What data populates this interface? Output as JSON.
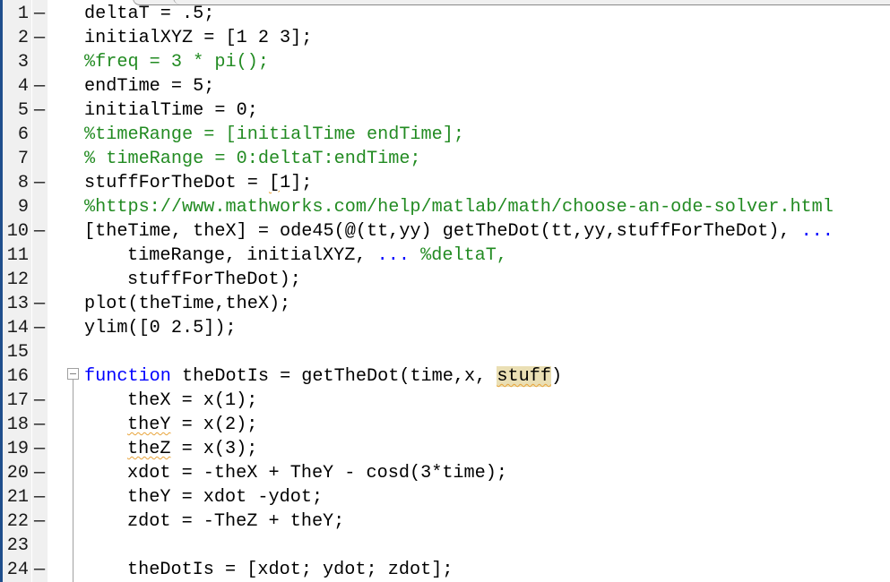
{
  "editor": {
    "language": "MATLAB",
    "colors": {
      "comment": "#228b22",
      "keyword": "#0000ff",
      "continuation": "#0000ff",
      "highlight": "#eadfb4",
      "warning_underline": "#e8a33a"
    },
    "lines": [
      {
        "number": "1",
        "executable": true,
        "tokens": [
          {
            "t": "deltaT = .5;"
          }
        ]
      },
      {
        "number": "2",
        "executable": true,
        "tokens": [
          {
            "t": "initialXYZ = [1 2 3];"
          }
        ]
      },
      {
        "number": "3",
        "executable": false,
        "tokens": [
          {
            "t": "%freq = 3 * pi();",
            "c": "comment"
          }
        ]
      },
      {
        "number": "4",
        "executable": true,
        "tokens": [
          {
            "t": "endTime = 5;"
          }
        ]
      },
      {
        "number": "5",
        "executable": true,
        "tokens": [
          {
            "t": "initialTime = 0;"
          }
        ]
      },
      {
        "number": "6",
        "executable": false,
        "tokens": [
          {
            "t": "%timeRange = [initialTime endTime];",
            "c": "comment"
          }
        ]
      },
      {
        "number": "7",
        "executable": false,
        "tokens": [
          {
            "t": "% timeRange = 0:deltaT:endTime;",
            "c": "comment"
          }
        ]
      },
      {
        "number": "8",
        "executable": true,
        "tokens": [
          {
            "t": "stuffForTheDot = "
          },
          {
            "t": "[",
            "c": "warn"
          },
          {
            "t": "1];"
          }
        ]
      },
      {
        "number": "9",
        "executable": false,
        "tokens": [
          {
            "t": "%https://www.mathworks.com/help/matlab/math/choose-an-ode-solver.html",
            "c": "comment"
          }
        ]
      },
      {
        "number": "10",
        "executable": true,
        "tokens": [
          {
            "t": "[theTime, theX] = ode45(@(tt,yy) getTheDot(tt,yy,stuffForTheDot), "
          },
          {
            "t": "...",
            "c": "cont"
          }
        ]
      },
      {
        "number": "11",
        "executable": false,
        "indent": 1,
        "tokens": [
          {
            "t": "timeRange, initialXYZ, "
          },
          {
            "t": "...",
            "c": "cont"
          },
          {
            "t": " %deltaT,",
            "c": "comment"
          }
        ]
      },
      {
        "number": "12",
        "executable": false,
        "indent": 1,
        "tokens": [
          {
            "t": "stuffForTheDot);"
          }
        ]
      },
      {
        "number": "13",
        "executable": true,
        "tokens": [
          {
            "t": "plot(theTime,theX);"
          }
        ]
      },
      {
        "number": "14",
        "executable": true,
        "tokens": [
          {
            "t": "ylim([0 2.5]);"
          }
        ]
      },
      {
        "number": "15",
        "executable": false,
        "tokens": []
      },
      {
        "number": "16",
        "executable": false,
        "fold": true,
        "tokens": [
          {
            "t": "function",
            "c": "keyword"
          },
          {
            "t": " theDotIs = getTheDot(time,x, "
          },
          {
            "t": "stuff",
            "c": "hlwarn"
          },
          {
            "t": ")"
          }
        ]
      },
      {
        "number": "17",
        "executable": true,
        "indent": 1,
        "tokens": [
          {
            "t": "theX = x(1);"
          }
        ]
      },
      {
        "number": "18",
        "executable": true,
        "indent": 1,
        "tokens": [
          {
            "t": "theY",
            "c": "warn"
          },
          {
            "t": " = x(2);"
          }
        ]
      },
      {
        "number": "19",
        "executable": true,
        "indent": 1,
        "tokens": [
          {
            "t": "theZ",
            "c": "warn"
          },
          {
            "t": " = x(3);"
          }
        ]
      },
      {
        "number": "20",
        "executable": true,
        "indent": 1,
        "tokens": [
          {
            "t": "xdot = -theX + TheY - cosd(3*time);"
          }
        ]
      },
      {
        "number": "21",
        "executable": true,
        "indent": 1,
        "tokens": [
          {
            "t": "theY = xdot -ydot;"
          }
        ]
      },
      {
        "number": "22",
        "executable": true,
        "indent": 1,
        "tokens": [
          {
            "t": "zdot = -TheZ + theY;"
          }
        ]
      },
      {
        "number": "23",
        "executable": false,
        "tokens": []
      },
      {
        "number": "24",
        "executable": true,
        "indent": 1,
        "tokens": [
          {
            "t": "theDotIs = [xdot; ydot; zdot];"
          }
        ]
      }
    ],
    "executable_marker": "—",
    "fold_icon": "fold-minus-icon"
  }
}
